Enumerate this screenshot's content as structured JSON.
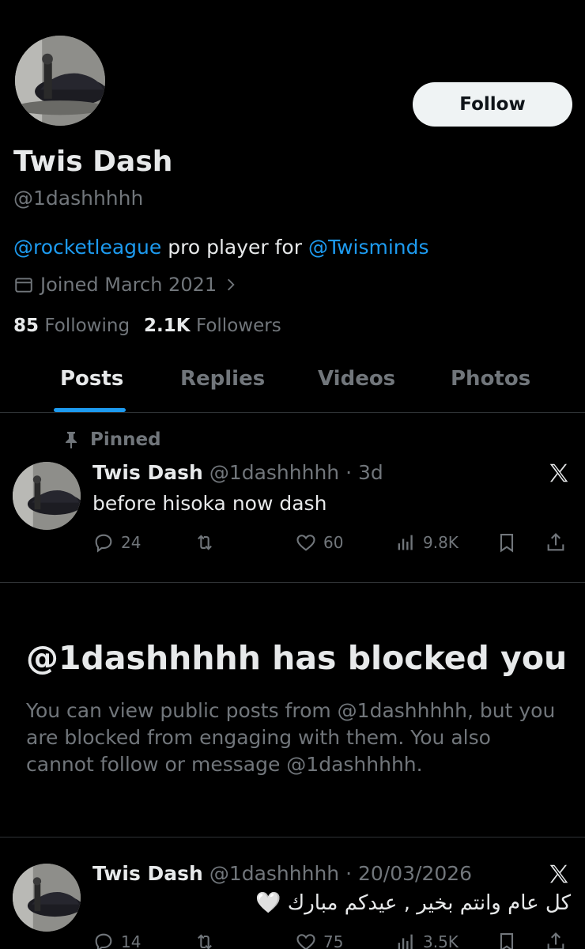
{
  "profile": {
    "display_name": "Twis Dash",
    "handle": "@1dashhhhh",
    "follow_label": "Follow",
    "bio": {
      "mention_1": "@rocketleague",
      "middle": " pro player for ",
      "mention_2": "@Twisminds"
    },
    "joined": "Joined March 2021",
    "following_count": "85",
    "following_label": "Following",
    "followers_count": "2.1K",
    "followers_label": "Followers"
  },
  "tabs": [
    {
      "label": "Posts",
      "active": true
    },
    {
      "label": "Replies",
      "active": false
    },
    {
      "label": "Videos",
      "active": false
    },
    {
      "label": "Photos",
      "active": false
    }
  ],
  "pinned_post": {
    "pinned_label": "Pinned",
    "name": "Twis Dash",
    "handle_time": "@1dashhhhh · 3d",
    "text": "before hisoka now dash",
    "replies": "24",
    "likes": "60",
    "views": "9.8K"
  },
  "blocked": {
    "title": "@1dashhhhh has blocked you",
    "message": "You can view public posts from @1dashhhhh, but you are blocked from engaging with them. You also cannot follow or message @1dashhhhh."
  },
  "second_post": {
    "name": "Twis Dash",
    "handle_time": "@1dashhhhh · 20/03/2026",
    "text": "كل عام وانتم بخير , عيدكم مبارك 🤍",
    "replies": "14",
    "likes": "75",
    "views": "3.5K"
  },
  "colors": {
    "background": "#000000",
    "text_primary": "#e7e9ea",
    "text_secondary": "#71767b",
    "accent": "#1d9bf0",
    "divider": "#2f3336"
  }
}
